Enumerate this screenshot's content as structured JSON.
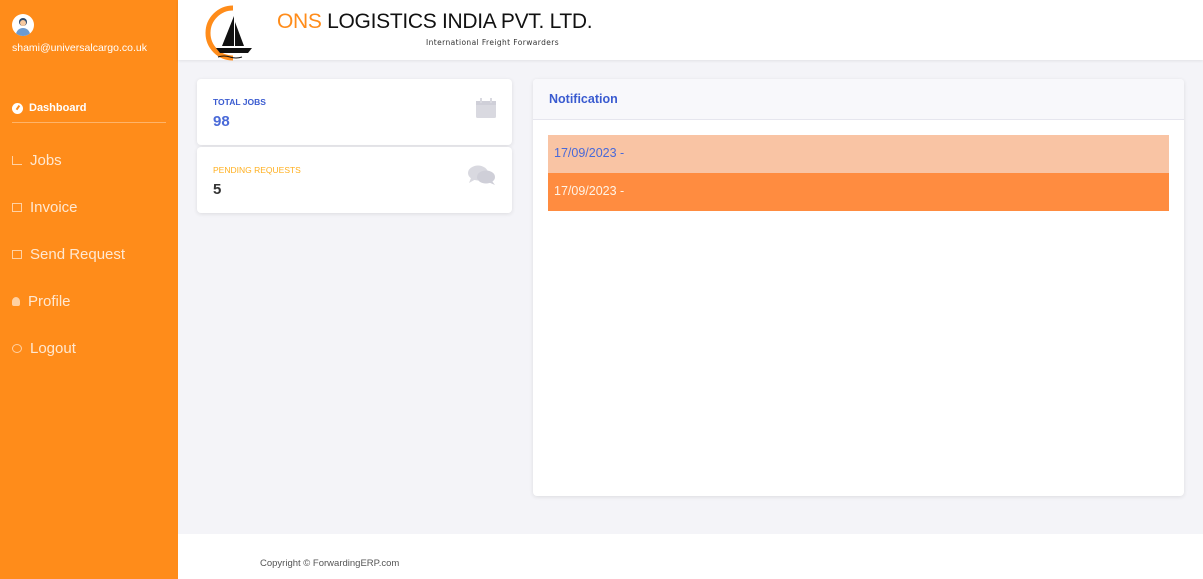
{
  "sidebar": {
    "user_email": "shami@universalcargo.co.uk",
    "dashboard_label": "Dashboard",
    "items": [
      {
        "label": "Jobs",
        "icon": "chart-icon"
      },
      {
        "label": "Invoice",
        "icon": "table-icon"
      },
      {
        "label": "Send Request",
        "icon": "table-icon"
      },
      {
        "label": "Profile",
        "icon": "person-icon"
      },
      {
        "label": "Logout",
        "icon": "logout-icon"
      }
    ]
  },
  "header": {
    "brand_ons": "ONS",
    "brand_rest": " LOGISTICS INDIA PVT. LTD.",
    "tagline": "International Freight Forwarders"
  },
  "stats": {
    "total_jobs_label": "TOTAL JOBS",
    "total_jobs_value": "98",
    "pending_label": "PENDING REQUESTS",
    "pending_value": "5"
  },
  "notification": {
    "title": "Notification",
    "rows": [
      {
        "text": "17/09/2023  -"
      },
      {
        "text": "17/09/2023  -"
      }
    ]
  },
  "footer": {
    "copyright": "Copyright © ForwardingERP.com"
  },
  "colors": {
    "sidebar": "#ff8c1a",
    "accent_blue": "#3a5bd0",
    "row_light": "#f9c4a4",
    "row_dark": "#ff8c40"
  }
}
